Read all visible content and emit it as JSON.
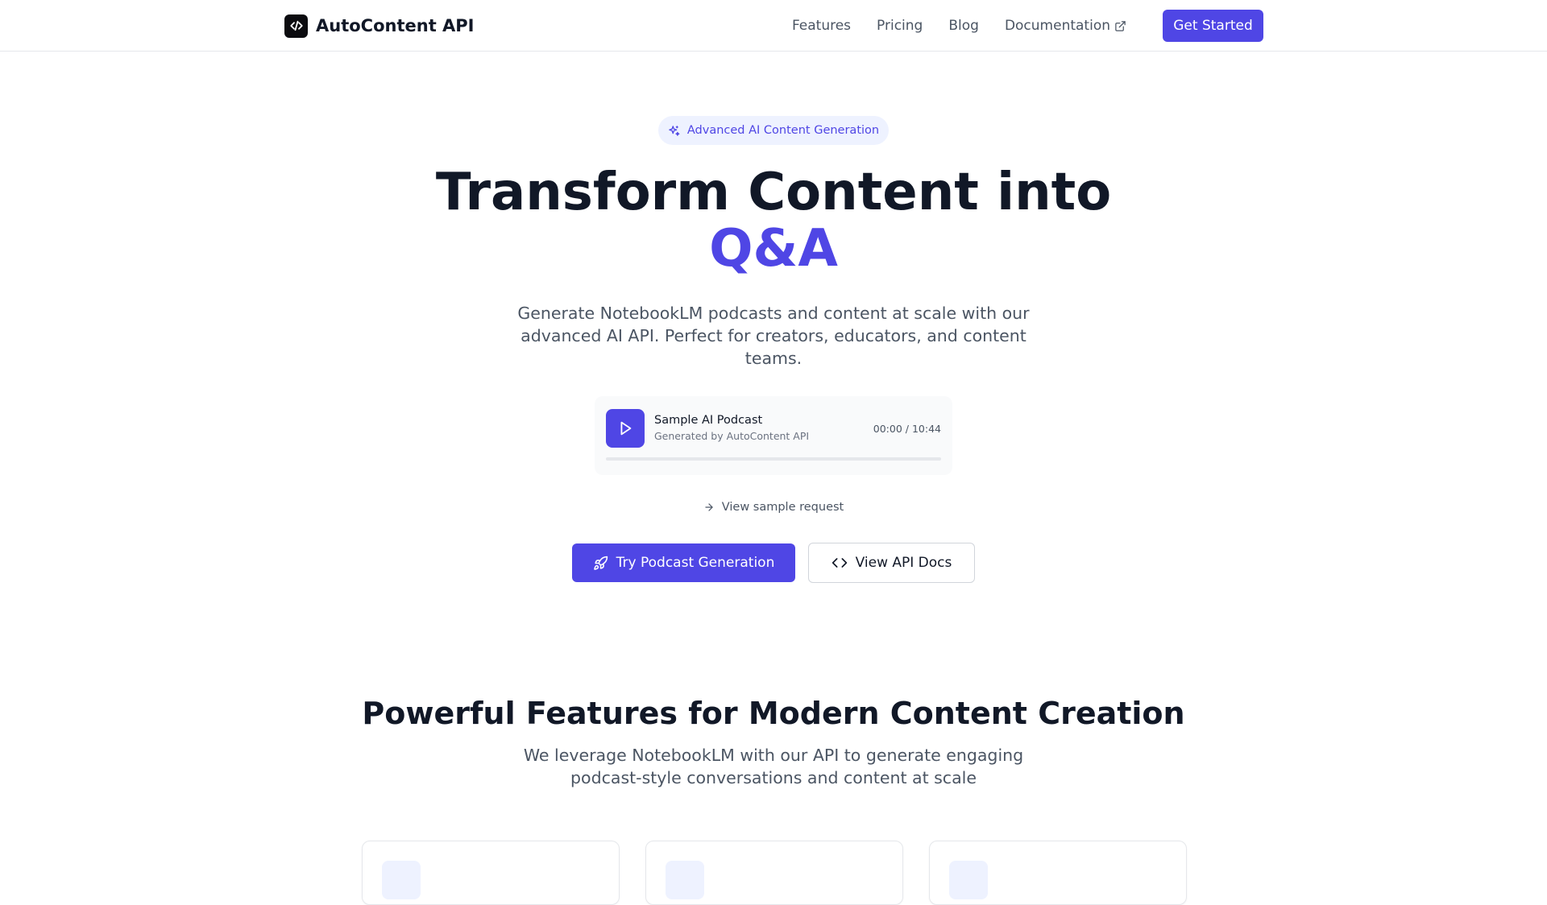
{
  "nav": {
    "brand": "AutoContent API",
    "brand_icon": "code-icon",
    "links": [
      {
        "label": "Features"
      },
      {
        "label": "Pricing"
      },
      {
        "label": "Blog"
      },
      {
        "label": "Documentation",
        "icon": "external-link-icon"
      }
    ],
    "cta": "Get Started"
  },
  "hero": {
    "badge": "Advanced AI Content Generation",
    "badge_icon": "sparkles-icon",
    "title_line1": "Transform Content into",
    "title_accent": "Q&A",
    "subtitle": "Generate NotebookLM podcasts and content at scale with our advanced AI API. Perfect for creators, educators, and content teams."
  },
  "player": {
    "title": "Sample AI Podcast",
    "subtitle": "Generated by AutoContent API",
    "time": "00:00 / 10:44",
    "progress": 0
  },
  "sample_link": "View sample request",
  "buttons": {
    "primary": "Try Podcast Generation",
    "primary_icon": "rocket-icon",
    "secondary": "View API Docs",
    "secondary_icon": "code-icon"
  },
  "features": {
    "title": "Powerful Features for Modern Content Creation",
    "subtitle": "We leverage NotebookLM with our API to generate engaging podcast-style conversations and content at scale"
  },
  "colors": {
    "accent": "#4f46e5",
    "badge_bg": "#eef2ff",
    "text": "#111827",
    "muted": "#4b5563"
  }
}
